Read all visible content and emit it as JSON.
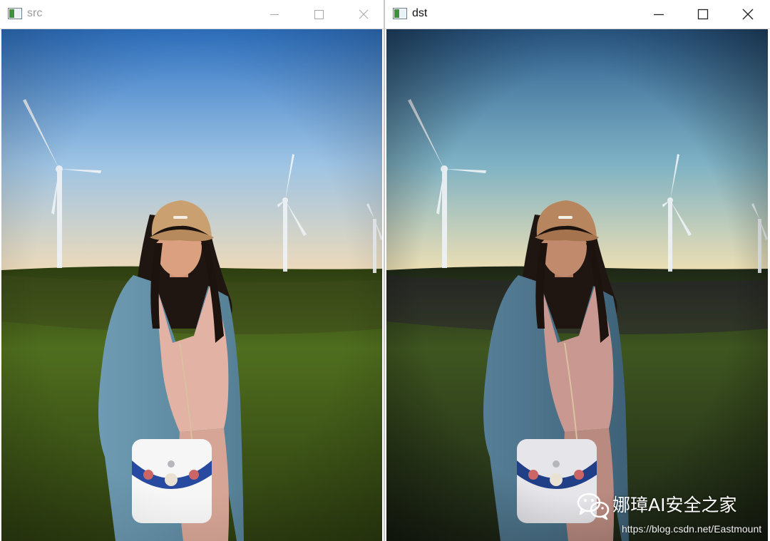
{
  "windows": [
    {
      "title": "src",
      "active": false,
      "controls": [
        "minimize",
        "maximize",
        "close"
      ],
      "image": {
        "tone": "original",
        "sky_top": "#2f73c4",
        "sky_mid": "#9ec4e4",
        "sky_horizon": "#f0dbb8",
        "grass": "#4f6e1e",
        "grass_dark": "#2d3d10"
      }
    },
    {
      "title": "dst",
      "active": true,
      "controls": [
        "minimize",
        "maximize",
        "close"
      ],
      "image": {
        "tone": "processed",
        "sky_top": "#2d5f90",
        "sky_mid": "#7fb2c4",
        "sky_horizon": "#f1e1b3",
        "grass": "#3f5620",
        "grass_dark": "#1d2616"
      }
    }
  ],
  "watermark": {
    "title": "娜璋AI安全之家",
    "url": "https://blog.csdn.net/Eastmount"
  }
}
